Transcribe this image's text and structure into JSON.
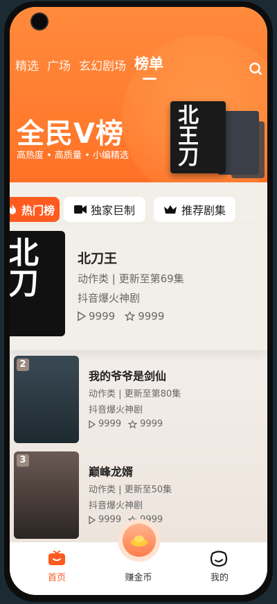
{
  "header": {
    "tabs": [
      {
        "label": "精选"
      },
      {
        "label": "广场"
      },
      {
        "label": "玄幻剧场"
      },
      {
        "label": "榜单"
      }
    ]
  },
  "hero": {
    "title": "全民V榜",
    "subtitle": "高热度 • 高质量 • 小编精选",
    "poster_text": "北王刀"
  },
  "categories": [
    {
      "label": "热门榜"
    },
    {
      "label": "独家巨制"
    },
    {
      "label": "推荐剧集"
    }
  ],
  "featured": {
    "title": "北刀王",
    "meta": "动作类 | 更新至第69集",
    "tag": "抖音爆火神剧",
    "plays": "9999",
    "favorites": "9999",
    "poster_text": "北刀"
  },
  "list": [
    {
      "rank": "2",
      "title": "我的爷爷是剑仙",
      "meta": "动作类 | 更新至第80集",
      "tag": "抖音爆火神剧",
      "plays": "9999",
      "favorites": "9999"
    },
    {
      "rank": "3",
      "title": "巅峰龙婿",
      "meta": "动作类 | 更新至50集",
      "tag": "抖音爆火神剧",
      "plays": "9999",
      "favorites": "9999"
    }
  ],
  "bottom_nav": [
    {
      "label": "首页"
    },
    {
      "label": "赚金币"
    },
    {
      "label": "我的"
    }
  ],
  "colors": {
    "accent": "#ff5a1f",
    "hero": "#ff7a2d"
  }
}
